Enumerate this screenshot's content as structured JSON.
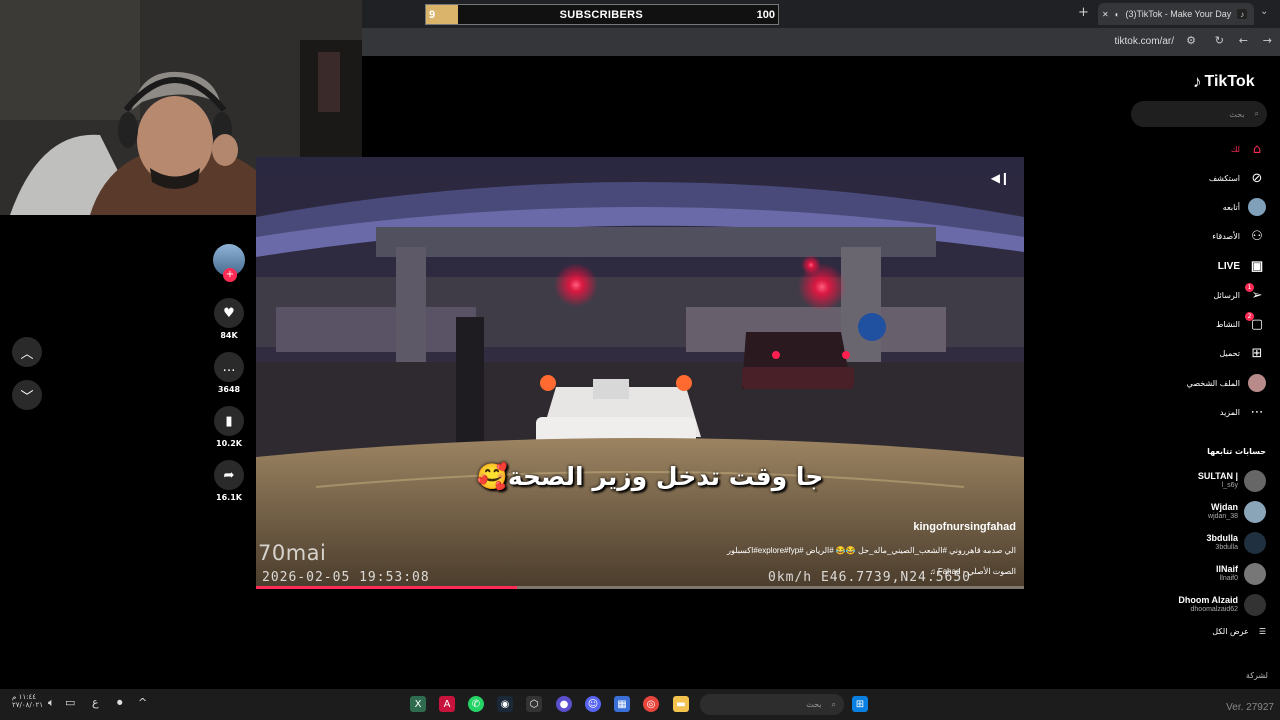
{
  "overlay": {
    "subscribers_label": "SUBSCRIBERS",
    "subscribers_current": "9",
    "subscribers_goal": "100",
    "progress_fraction": 0.09
  },
  "browser": {
    "tab_title": "(3)TikTok - Make Your Day",
    "url": "tiktok.com/ar/"
  },
  "tiktok": {
    "logo": "TikTok",
    "search_placeholder": "بحث",
    "nav": [
      {
        "label": "لك",
        "icon": "home-icon",
        "active": true
      },
      {
        "label": "استكشف",
        "icon": "compass-icon"
      },
      {
        "label": "أتابعه",
        "icon": "following-avatar-icon"
      },
      {
        "label": "الأصدقاء",
        "icon": "friends-icon"
      },
      {
        "label": "LIVE",
        "icon": "live-icon"
      },
      {
        "label": "الرسائل",
        "icon": "send-icon",
        "badge": "1"
      },
      {
        "label": "النشاط",
        "icon": "activity-icon",
        "badge": "2"
      },
      {
        "label": "تحميل",
        "icon": "upload-icon"
      },
      {
        "label": "الملف الشخصي",
        "icon": "profile-avatar-icon"
      },
      {
        "label": "المزيد",
        "icon": "more-icon"
      }
    ],
    "following_title": "حسابات تتابعها",
    "accounts": [
      {
        "name": "SULTAN |",
        "handle": "l_s6y"
      },
      {
        "name": "Wjdan",
        "handle": "wjdan_38"
      },
      {
        "name": "3bdulla",
        "handle": "3bdulla"
      },
      {
        "name": "llNaif",
        "handle": "llnaif0"
      },
      {
        "name": "Dhoom Alzaid",
        "handle": "dhoomalzaid62"
      }
    ],
    "see_all": "عرض الكل",
    "company": "لشركة"
  },
  "video": {
    "caption_overlay": "جا وقت تدخل وزير الصحة🥰",
    "brand": "70mai",
    "timestamp": "2026-02-05  19:53:08",
    "speed_readout": "0km/h  E46.7739,N24.5650",
    "username": "kingofnursingfahad",
    "description": "الي صدمه قاهرروني  #الشعب_الصيني_ماله_حل 😂😂 #الرياض #explore#fyp#اكسبلور",
    "music": "♫  Fahad - الصوت الأصلي",
    "progress_fraction": 0.34,
    "likes": "84K",
    "comments": "3648",
    "saves": "10.2K",
    "shares": "16.1K"
  },
  "taskbar": {
    "search_placeholder": "بحث",
    "clock_time": "١١:٤٤ م",
    "clock_date": "٢٧/٠٨/٠٢١",
    "lang": "ع"
  },
  "version": "Ver. 27927"
}
